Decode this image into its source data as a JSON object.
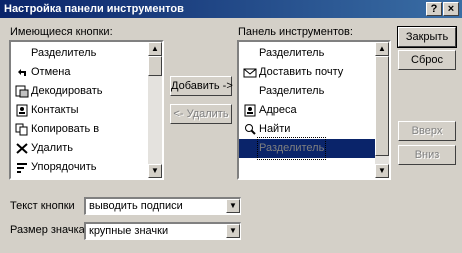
{
  "window": {
    "title": "Настройка панели инструментов",
    "help_button": "?",
    "close_button": "×"
  },
  "available": {
    "label": "Имеющиеся кнопки:",
    "items": [
      {
        "label": "Разделитель",
        "icon": "separator-icon"
      },
      {
        "label": "Отмена",
        "icon": "cancel-icon"
      },
      {
        "label": "Декодировать",
        "icon": "decode-icon"
      },
      {
        "label": "Контакты",
        "icon": "contacts-icon"
      },
      {
        "label": "Копировать в",
        "icon": "copy-to-icon"
      },
      {
        "label": "Удалить",
        "icon": "delete-icon"
      },
      {
        "label": "Упорядочить",
        "icon": "sort-icon"
      }
    ]
  },
  "current": {
    "label": "Панель инструментов:",
    "items": [
      {
        "label": "Разделитель",
        "icon": "separator-icon"
      },
      {
        "label": "Доставить почту",
        "icon": "deliver-mail-icon"
      },
      {
        "label": "Разделитель",
        "icon": "separator-icon"
      },
      {
        "label": "Адреса",
        "icon": "address-book-icon"
      },
      {
        "label": "Найти",
        "icon": "find-icon"
      },
      {
        "label": "Разделитель",
        "icon": "separator-icon",
        "selected": true
      }
    ]
  },
  "buttons": {
    "add": "Добавить ->",
    "remove": "<- Удалить",
    "close": "Закрыть",
    "reset": "Сброс",
    "up": "Вверх",
    "down": "Вниз"
  },
  "options": {
    "text_label": "Текст кнопки",
    "text_value": "выводить подписи",
    "size_label": "Размер значка:",
    "size_value": "крупные значки"
  },
  "colors": {
    "selection": "#0a246a",
    "face": "#d4d0c8"
  }
}
